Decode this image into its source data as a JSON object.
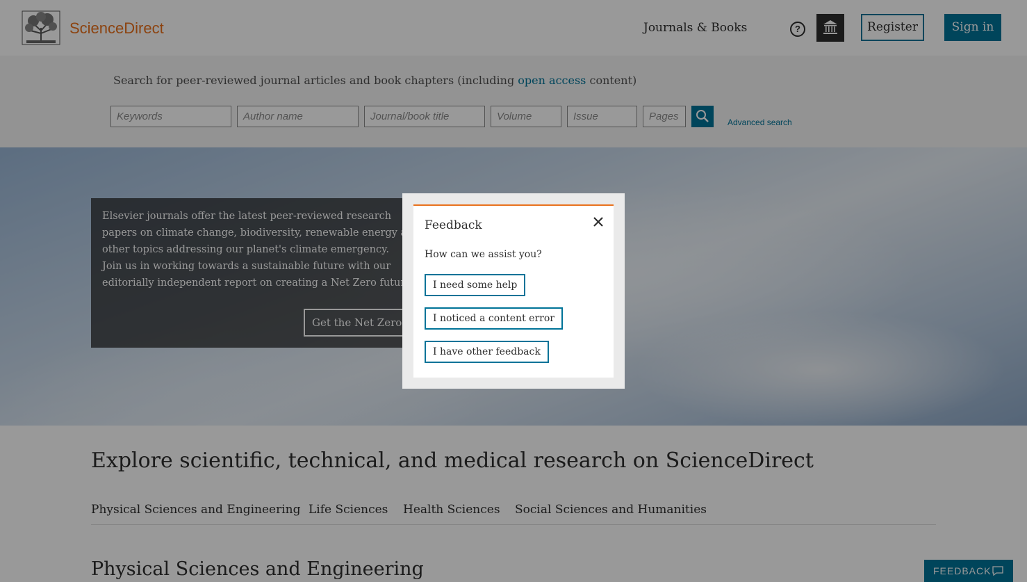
{
  "header": {
    "brand": "ScienceDirect",
    "nav_journals": "Journals & Books",
    "help_icon": "help-circle-icon",
    "institution_icon": "institution-icon",
    "register_label": "Register",
    "signin_label": "Sign in"
  },
  "search": {
    "intro_before": "Search for peer-reviewed journal articles and book chapters (including ",
    "intro_link": "open access",
    "intro_after": " content)",
    "keywords_placeholder": "Keywords",
    "author_placeholder": "Author name",
    "journal_placeholder": "Journal/book title",
    "volume_placeholder": "Volume",
    "issue_placeholder": "Issue",
    "pages_placeholder": "Pages",
    "submit_icon": "search-icon",
    "advanced_label": "Advanced search"
  },
  "hero": {
    "text_line1": "Elsevier journals offer the latest peer-reviewed research papers on climate change, biodiversity, renewable energy and other topics addressing our planet's climate emergency.",
    "text_line2": "Join us in working towards a sustainable future with our editorially independent report on creating a Net Zero future.",
    "button_label": "Get the Net Zero re"
  },
  "explore": {
    "title": "Explore scientific, technical, and medical research on ScienceDirect",
    "tabs": [
      {
        "label": "Physical Sciences and Engineering"
      },
      {
        "label": "Life Sciences"
      },
      {
        "label": "Health Sciences"
      },
      {
        "label": "Social Sciences and Humanities"
      }
    ],
    "section_title": "Physical Sciences and Engineering"
  },
  "feedback_tab": {
    "label": "FEEDBACK",
    "icon": "chat-bubble-icon"
  },
  "modal": {
    "title": "Feedback",
    "close_icon": "close-icon",
    "question": "How can we assist you?",
    "options": [
      {
        "label": "I need some help"
      },
      {
        "label": "I noticed a content error"
      },
      {
        "label": "I have other feedback"
      }
    ]
  },
  "colors": {
    "brand_orange": "#e9711c",
    "accent_blue": "#007398",
    "text_dark": "#2e2e2e"
  }
}
